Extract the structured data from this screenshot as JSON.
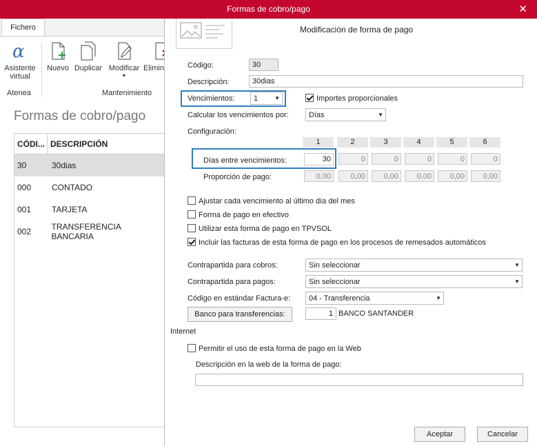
{
  "window": {
    "title": "Formas de cobro/pago",
    "close_glyph": "✕"
  },
  "ribbon": {
    "tab": "Fichero",
    "buttons": {
      "asistente": "Asistente virtual",
      "nuevo": "Nuevo",
      "duplicar": "Duplicar",
      "modificar": "Modificar",
      "eliminar": "Elimin"
    },
    "groups": {
      "atenea": "Atenea",
      "mantenimiento": "Mantenimiento"
    }
  },
  "list": {
    "title": "Formas de cobro/pago",
    "col_code": "CÓDI...",
    "col_desc": "DESCRIPCIÓN",
    "rows": [
      {
        "code": "30",
        "desc": "30dias"
      },
      {
        "code": "000",
        "desc": "CONTADO"
      },
      {
        "code": "001",
        "desc": "TARJETA"
      },
      {
        "code": "002",
        "desc": "TRANSFERENCIA BANCARIA"
      }
    ]
  },
  "dialog": {
    "title": "Modificación de forma de pago",
    "codigo_label": "Código:",
    "codigo_value": "30",
    "descripcion_label": "Descripción:",
    "descripcion_value": "30dias",
    "vencimientos_label": "Vencimientos:",
    "vencimientos_value": "1",
    "importes_label": "Importes proporcionales",
    "calcular_label": "Calcular los vencimientos por:",
    "calcular_value": "Días",
    "configuracion_label": "Configuración:",
    "columns": [
      "1",
      "2",
      "3",
      "4",
      "5",
      "6"
    ],
    "dias_label": "Días entre vencimientos:",
    "dias_values": [
      "30",
      "0",
      "0",
      "0",
      "0",
      "0"
    ],
    "proporcion_label": "Proporción de pago:",
    "proporcion_values": [
      "0,00",
      "0,00",
      "0,00",
      "0,00",
      "0,00",
      "0,00"
    ],
    "checks": {
      "ajustar": "Ajustar cada vencimiento al último día del mes",
      "efectivo": "Forma de pago en efectivo",
      "tpvsol": "Utilizar esta forma de pago en TPVSOL",
      "incluir": "Incluir las facturas de esta forma de pago en los procesos de remesados automáticos"
    },
    "contra_cobros_label": "Contrapartida para cobros:",
    "contra_cobros_value": "Sin seleccionar",
    "contra_pagos_label": "Contrapartida para pagos:",
    "contra_pagos_value": "Sin seleccionar",
    "factura_label": "Código en estándar Factura-e:",
    "factura_value": "04 - Transferencia",
    "banco_button": "Banco para transferencias:",
    "banco_num": "1",
    "banco_name": "BANCO SANTANDER",
    "internet_label": "Internet",
    "permitir_label": "Permitir el uso de esta forma de pago en la Web",
    "desc_web_label": "Descripción en la web de la forma de pago:",
    "desc_web_value": "",
    "aceptar": "Aceptar",
    "cancelar": "Cancelar"
  },
  "colors": {
    "title_bar": "#c3072e",
    "highlight": "#2e7fc2"
  }
}
